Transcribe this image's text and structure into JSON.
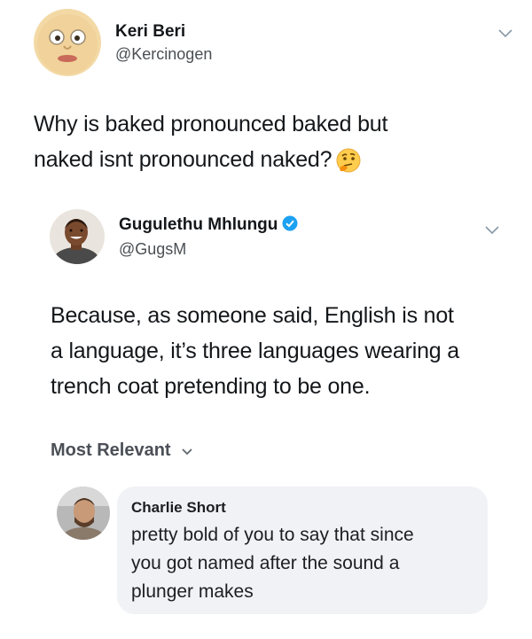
{
  "tweet1": {
    "display_name": "Keri Beri",
    "handle": "@Kercinogen",
    "text_lines": [
      "Why is baked pronounced baked but",
      "naked isnt pronounced naked?"
    ],
    "emoji": "thinking-face"
  },
  "tweet2": {
    "display_name": "Gugulethu Mhlungu",
    "handle": "@GugsM",
    "verified": true,
    "text_lines": [
      "Because, as someone said, English is not",
      "a language, it’s three languages wearing a",
      "trench coat pretending to be one."
    ]
  },
  "comments": {
    "sort_label": "Most Relevant",
    "items": [
      {
        "author": "Charlie Short",
        "text_lines": [
          "pretty bold of you to say that since",
          "you got named after the sound a",
          "plunger makes"
        ]
      }
    ]
  },
  "colors": {
    "verified": "#1da1f2",
    "bubble": "#f0f2f5",
    "chevron": "#8899a6"
  }
}
